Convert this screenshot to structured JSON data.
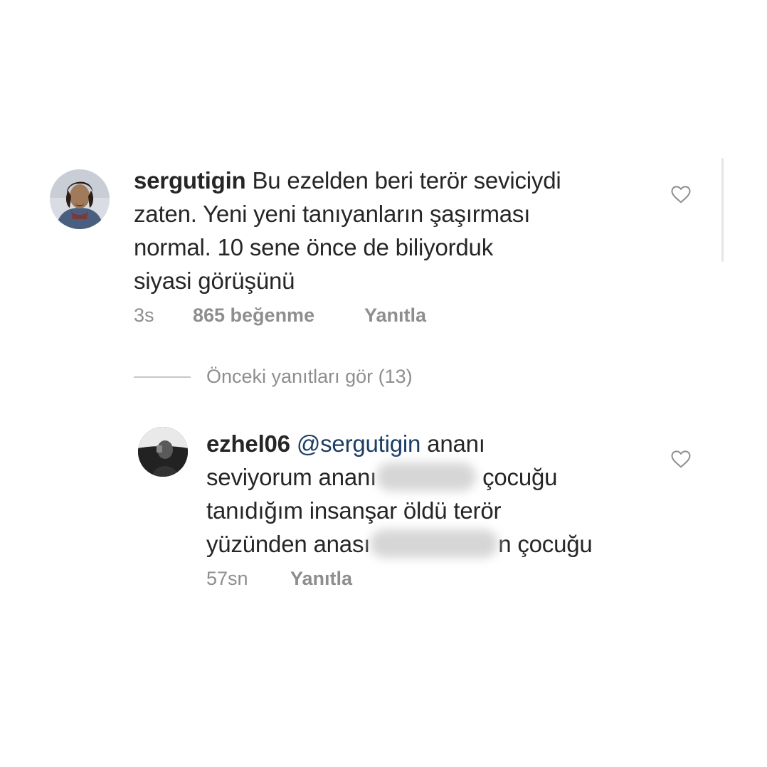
{
  "comments": [
    {
      "username": "sergutigin",
      "text_lines": [
        "Bu ezelden beri terör seviciydi",
        "zaten. Yeni yeni tanıyanların şaşırması",
        "normal. 10 sene önce de biliyorduk",
        "siyasi görüşünü"
      ],
      "time": "3s",
      "likes": "865 beğenme",
      "reply_label": "Yanıtla",
      "avatar_icon": "user-avatar-icon",
      "like_icon": "heart-outline-icon"
    }
  ],
  "replies_toggle": {
    "label": "Önceki yanıtları gör (13)"
  },
  "reply": {
    "username": "ezhel06",
    "mention": "@sergutigin",
    "line1_rest": " ananı",
    "line2_before": "seviyorum ananı",
    "line2_after": " çocuğu",
    "line3": "tanıdığım insanşar öldü terör",
    "line4_before": "yüzünden anası",
    "line4_after": "n çocuğu",
    "time": "57sn",
    "reply_label": "Yanıtla",
    "avatar_icon": "user-avatar-icon",
    "like_icon": "heart-outline-icon"
  },
  "colors": {
    "text": "#262626",
    "secondary": "#8e8e8e",
    "mention": "#1c3d66",
    "divider": "#c7c7c7"
  }
}
